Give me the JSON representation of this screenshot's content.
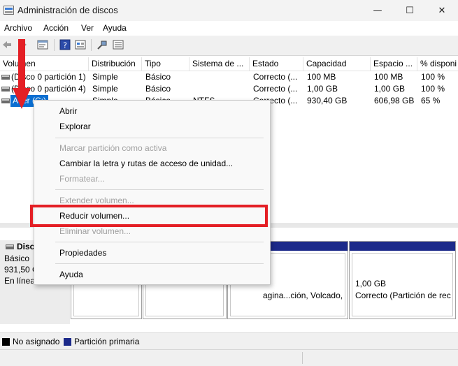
{
  "window": {
    "title": "Administración de discos",
    "controls": {
      "minimize": "—",
      "maximize": "☐",
      "close": "✕"
    }
  },
  "menu": [
    "Archivo",
    "Acción",
    "Ver",
    "Ayuda"
  ],
  "toolbar": {
    "icons": [
      "back-icon",
      "forward-icon",
      "properties-icon",
      "help-icon",
      "refresh-icon",
      "connect-icon",
      "list-icon"
    ]
  },
  "volume_list": {
    "columns": [
      "Volumen",
      "Distribución",
      "Tipo",
      "Sistema de ...",
      "Estado",
      "Capacidad",
      "Espacio ...",
      "% disponi"
    ],
    "rows": [
      {
        "volume": "(Disco 0 partición 1)",
        "layout": "Simple",
        "type": "Básico",
        "fs": "",
        "status": "Correcto (...",
        "capacity": "100 MB",
        "free": "100 MB",
        "percent": "100 %"
      },
      {
        "volume": "(Disco 0 partición 4)",
        "layout": "Simple",
        "type": "Básico",
        "fs": "",
        "status": "Correcto (...",
        "capacity": "1,00 GB",
        "free": "1,00 GB",
        "percent": "100 %"
      },
      {
        "volume": "Acer (C:)",
        "layout": "Simple",
        "type": "Básico",
        "fs": "NTFS",
        "status": "Correcto (...",
        "capacity": "930,40 GB",
        "free": "606,98 GB",
        "percent": "65 %"
      }
    ]
  },
  "disk_map": {
    "disk": {
      "name": "Disco",
      "type": "Básico",
      "size": "931,50 G",
      "state": "En línea"
    },
    "partitions": [
      {
        "size": "",
        "status": ""
      },
      {
        "size": "",
        "status": ""
      },
      {
        "size": "",
        "status": "agina...ción, Volcado,"
      },
      {
        "size": "1,00 GB",
        "status": "Correcto (Partición de rec"
      }
    ]
  },
  "legend": {
    "unallocated": "No asignado",
    "primary": "Partición primaria",
    "colors": {
      "unallocated": "#000000",
      "primary": "#1c2a8a"
    }
  },
  "context_menu": {
    "items": [
      {
        "label": "Abrir",
        "enabled": true
      },
      {
        "label": "Explorar",
        "enabled": true
      },
      {
        "label": "Marcar partición como activa",
        "enabled": false
      },
      {
        "label": "Cambiar la letra y rutas de acceso de unidad...",
        "enabled": true
      },
      {
        "label": "Formatear...",
        "enabled": false
      },
      {
        "label": "Extender volumen...",
        "enabled": false
      },
      {
        "label": "Reducir volumen...",
        "enabled": true
      },
      {
        "label": "Eliminar volumen...",
        "enabled": false
      },
      {
        "label": "Propiedades",
        "enabled": true
      },
      {
        "label": "Ayuda",
        "enabled": true
      }
    ]
  },
  "annotation": {
    "highlight_color": "#e41f25"
  }
}
